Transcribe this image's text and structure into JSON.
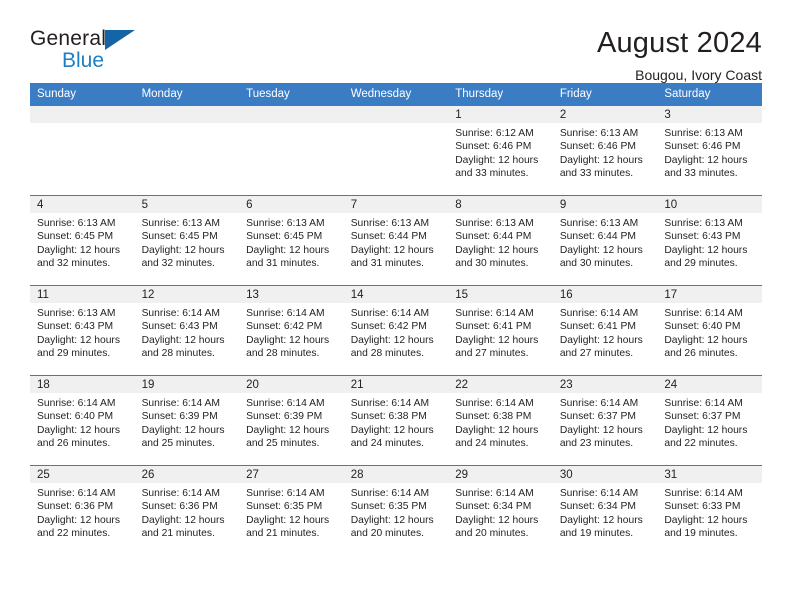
{
  "brand": {
    "name_top": "General",
    "name_bottom": "Blue",
    "triangle_color": "#1565a6",
    "blue_text_color": "#1f7fc4"
  },
  "header": {
    "title": "August 2024",
    "subtitle": "Bougou, Ivory Coast"
  },
  "theme": {
    "header_blue": "#3b7dc4",
    "daynum_band": "#f0f0f0",
    "text": "#231f20"
  },
  "calendar": {
    "weekday_headers": [
      "Sunday",
      "Monday",
      "Tuesday",
      "Wednesday",
      "Thursday",
      "Friday",
      "Saturday"
    ],
    "weeks": [
      [
        {
          "day": "",
          "lines": ""
        },
        {
          "day": "",
          "lines": ""
        },
        {
          "day": "",
          "lines": ""
        },
        {
          "day": "",
          "lines": ""
        },
        {
          "day": "1",
          "lines": "Sunrise: 6:12 AM\nSunset: 6:46 PM\nDaylight: 12 hours\nand 33 minutes."
        },
        {
          "day": "2",
          "lines": "Sunrise: 6:13 AM\nSunset: 6:46 PM\nDaylight: 12 hours\nand 33 minutes."
        },
        {
          "day": "3",
          "lines": "Sunrise: 6:13 AM\nSunset: 6:46 PM\nDaylight: 12 hours\nand 33 minutes."
        }
      ],
      [
        {
          "day": "4",
          "lines": "Sunrise: 6:13 AM\nSunset: 6:45 PM\nDaylight: 12 hours\nand 32 minutes."
        },
        {
          "day": "5",
          "lines": "Sunrise: 6:13 AM\nSunset: 6:45 PM\nDaylight: 12 hours\nand 32 minutes."
        },
        {
          "day": "6",
          "lines": "Sunrise: 6:13 AM\nSunset: 6:45 PM\nDaylight: 12 hours\nand 31 minutes."
        },
        {
          "day": "7",
          "lines": "Sunrise: 6:13 AM\nSunset: 6:44 PM\nDaylight: 12 hours\nand 31 minutes."
        },
        {
          "day": "8",
          "lines": "Sunrise: 6:13 AM\nSunset: 6:44 PM\nDaylight: 12 hours\nand 30 minutes."
        },
        {
          "day": "9",
          "lines": "Sunrise: 6:13 AM\nSunset: 6:44 PM\nDaylight: 12 hours\nand 30 minutes."
        },
        {
          "day": "10",
          "lines": "Sunrise: 6:13 AM\nSunset: 6:43 PM\nDaylight: 12 hours\nand 29 minutes."
        }
      ],
      [
        {
          "day": "11",
          "lines": "Sunrise: 6:13 AM\nSunset: 6:43 PM\nDaylight: 12 hours\nand 29 minutes."
        },
        {
          "day": "12",
          "lines": "Sunrise: 6:14 AM\nSunset: 6:43 PM\nDaylight: 12 hours\nand 28 minutes."
        },
        {
          "day": "13",
          "lines": "Sunrise: 6:14 AM\nSunset: 6:42 PM\nDaylight: 12 hours\nand 28 minutes."
        },
        {
          "day": "14",
          "lines": "Sunrise: 6:14 AM\nSunset: 6:42 PM\nDaylight: 12 hours\nand 28 minutes."
        },
        {
          "day": "15",
          "lines": "Sunrise: 6:14 AM\nSunset: 6:41 PM\nDaylight: 12 hours\nand 27 minutes."
        },
        {
          "day": "16",
          "lines": "Sunrise: 6:14 AM\nSunset: 6:41 PM\nDaylight: 12 hours\nand 27 minutes."
        },
        {
          "day": "17",
          "lines": "Sunrise: 6:14 AM\nSunset: 6:40 PM\nDaylight: 12 hours\nand 26 minutes."
        }
      ],
      [
        {
          "day": "18",
          "lines": "Sunrise: 6:14 AM\nSunset: 6:40 PM\nDaylight: 12 hours\nand 26 minutes."
        },
        {
          "day": "19",
          "lines": "Sunrise: 6:14 AM\nSunset: 6:39 PM\nDaylight: 12 hours\nand 25 minutes."
        },
        {
          "day": "20",
          "lines": "Sunrise: 6:14 AM\nSunset: 6:39 PM\nDaylight: 12 hours\nand 25 minutes."
        },
        {
          "day": "21",
          "lines": "Sunrise: 6:14 AM\nSunset: 6:38 PM\nDaylight: 12 hours\nand 24 minutes."
        },
        {
          "day": "22",
          "lines": "Sunrise: 6:14 AM\nSunset: 6:38 PM\nDaylight: 12 hours\nand 24 minutes."
        },
        {
          "day": "23",
          "lines": "Sunrise: 6:14 AM\nSunset: 6:37 PM\nDaylight: 12 hours\nand 23 minutes."
        },
        {
          "day": "24",
          "lines": "Sunrise: 6:14 AM\nSunset: 6:37 PM\nDaylight: 12 hours\nand 22 minutes."
        }
      ],
      [
        {
          "day": "25",
          "lines": "Sunrise: 6:14 AM\nSunset: 6:36 PM\nDaylight: 12 hours\nand 22 minutes."
        },
        {
          "day": "26",
          "lines": "Sunrise: 6:14 AM\nSunset: 6:36 PM\nDaylight: 12 hours\nand 21 minutes."
        },
        {
          "day": "27",
          "lines": "Sunrise: 6:14 AM\nSunset: 6:35 PM\nDaylight: 12 hours\nand 21 minutes."
        },
        {
          "day": "28",
          "lines": "Sunrise: 6:14 AM\nSunset: 6:35 PM\nDaylight: 12 hours\nand 20 minutes."
        },
        {
          "day": "29",
          "lines": "Sunrise: 6:14 AM\nSunset: 6:34 PM\nDaylight: 12 hours\nand 20 minutes."
        },
        {
          "day": "30",
          "lines": "Sunrise: 6:14 AM\nSunset: 6:34 PM\nDaylight: 12 hours\nand 19 minutes."
        },
        {
          "day": "31",
          "lines": "Sunrise: 6:14 AM\nSunset: 6:33 PM\nDaylight: 12 hours\nand 19 minutes."
        }
      ]
    ]
  }
}
